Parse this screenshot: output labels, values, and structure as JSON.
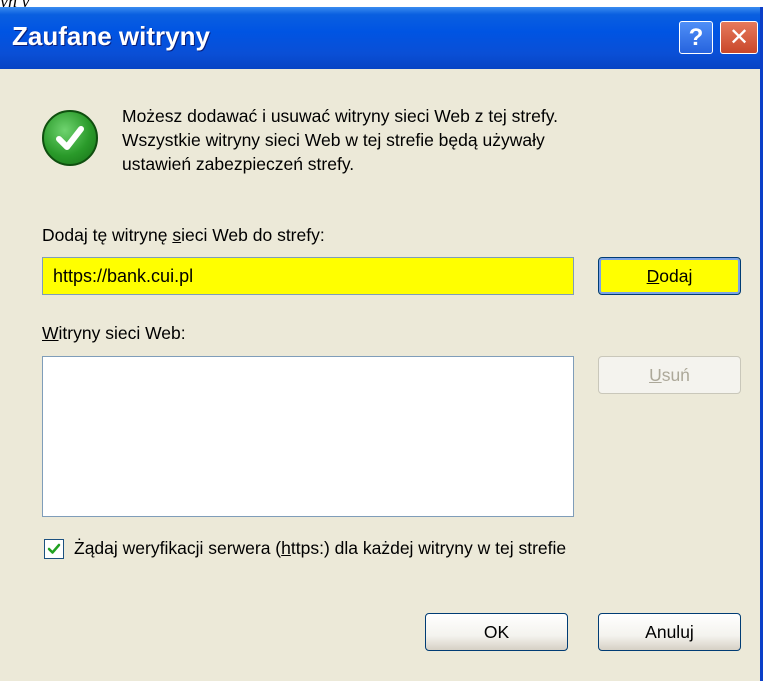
{
  "window": {
    "title": "Zaufane witryny",
    "help_glyph": "?",
    "close_glyph": "✕",
    "top_text_fragment": "yn  y"
  },
  "info": {
    "icon": "green-checkmark-icon",
    "lines": [
      "Możesz dodawać i usuwać witryny sieci Web z tej strefy.",
      "Wszystkie witryny sieci Web w tej strefie będą używały",
      "ustawień zabezpieczeń strefy."
    ]
  },
  "add_site": {
    "label_before": "Dodaj tę witrynę ",
    "label_underlined": "s",
    "label_after": "ieci Web do strefy:",
    "input_value": "https://bank.cui.pl",
    "button_underlined": "D",
    "button_rest": "odaj"
  },
  "sites": {
    "label_underlined": "W",
    "label_rest": "itryny sieci Web:",
    "items": [],
    "remove_underlined": "U",
    "remove_rest": "suń"
  },
  "verify": {
    "checked": true,
    "label_before": "Żądaj weryfikacji serwera (",
    "label_underlined": "h",
    "label_after": "ttps:) dla każdej witryny w tej strefie"
  },
  "footer": {
    "ok_label": "OK",
    "cancel_label": "Anuluj"
  },
  "colors": {
    "titlebar": "#0054e3",
    "dialog_bg": "#ece9d8",
    "highlight": "#ffff00",
    "check_green": "#2a9a2a"
  }
}
